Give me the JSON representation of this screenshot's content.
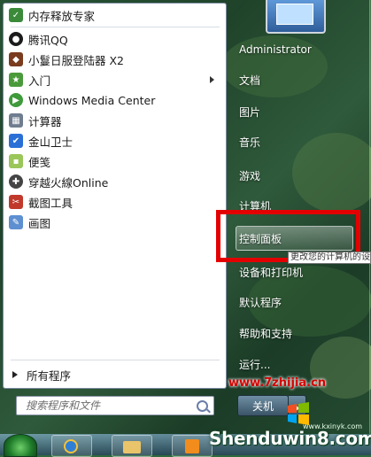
{
  "left_menu": {
    "items": [
      {
        "label": "内存释放专家",
        "icon": "broom-icon",
        "color": "#3a8a3a"
      },
      {
        "label": "腾讯QQ",
        "icon": "penguin-icon",
        "color": "#1b1b1b"
      },
      {
        "label": "小鬘日服登陆器 X2",
        "icon": "launcher-icon",
        "color": "#7a3b1e"
      },
      {
        "label": "入门",
        "icon": "getting-started-icon",
        "color": "#4a9a3c",
        "has_submenu": true
      },
      {
        "label": "Windows Media Center",
        "icon": "media-center-icon",
        "color": "#3e9a3a"
      },
      {
        "label": "计算器",
        "icon": "calculator-icon",
        "color": "#6f7d8f"
      },
      {
        "label": "金山卫士",
        "icon": "shield-icon",
        "color": "#2a6fd6"
      },
      {
        "label": "便笺",
        "icon": "sticky-note-icon",
        "color": "#9ac65a"
      },
      {
        "label": "穿越火線Online",
        "icon": "crossfire-icon",
        "color": "#444444"
      },
      {
        "label": "截图工具",
        "icon": "scissors-icon",
        "color": "#c0392b"
      },
      {
        "label": "画图",
        "icon": "palette-icon",
        "color": "#5d8fd1"
      }
    ],
    "all_programs": "所有程序",
    "search_placeholder": "搜索程序和文件"
  },
  "right_menu": {
    "user": "Administrator",
    "items": [
      "文档",
      "图片",
      "音乐",
      "游戏",
      "计算机",
      "控制面板",
      "设备和打印机",
      "默认程序",
      "帮助和支持",
      "运行..."
    ],
    "tooltip": "更改您的计算机的设置",
    "shutdown": "关机"
  },
  "watermarks": {
    "site": "www.7zhijia.cn",
    "brand": "Shenduwin8.com",
    "small": "www.kxinyk.com"
  },
  "colors": {
    "highlight_box": "#e30000"
  }
}
